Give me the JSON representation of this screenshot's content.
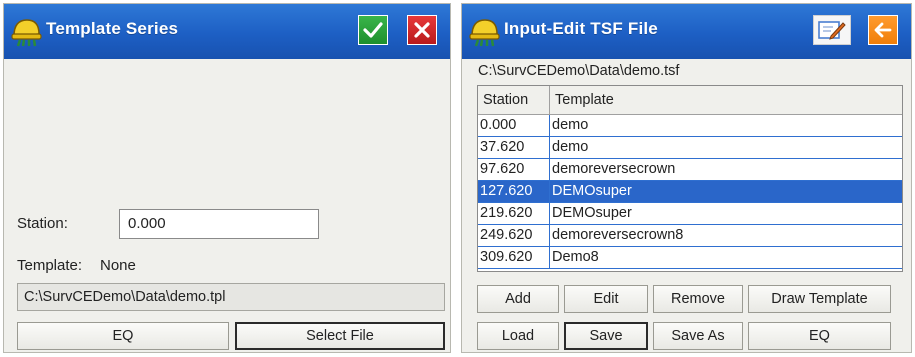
{
  "left_window": {
    "title": "Template Series",
    "station_label": "Station:",
    "station_value": "0.000",
    "template_label": "Template:",
    "template_value": "None",
    "template_path": "C:\\SurvCEDemo\\Data\\demo.tpl",
    "eq_button": "EQ",
    "select_file_button": "Select File"
  },
  "right_window": {
    "title": "Input-Edit TSF File",
    "file_path": "C:\\SurvCEDemo\\Data\\demo.tsf",
    "columns": [
      "Station",
      "Template"
    ],
    "rows": [
      {
        "station": "0.000",
        "template": "demo"
      },
      {
        "station": "37.620",
        "template": "demo"
      },
      {
        "station": "97.620",
        "template": "demoreversecrown"
      },
      {
        "station": "127.620",
        "template": "DEMOsuper"
      },
      {
        "station": "219.620",
        "template": "DEMOsuper"
      },
      {
        "station": "249.620",
        "template": "demoreversecrown8"
      },
      {
        "station": "309.620",
        "template": "Demo8"
      }
    ],
    "selected_row": 3,
    "buttons": {
      "add": "Add",
      "edit": "Edit",
      "remove": "Remove",
      "draw_template": "Draw Template",
      "load": "Load",
      "save": "Save",
      "save_as": "Save As",
      "eq": "EQ"
    }
  },
  "colors": {
    "titlebar": "#1d5fc4",
    "selection": "#2a66c9",
    "ok": "#1e8f2d",
    "cancel": "#b81a1c",
    "back": "#f07f0a"
  },
  "icons": {
    "app": "helmet-icon",
    "ok": "checkmark-icon",
    "cancel": "close-icon",
    "edit": "edit-pencil-icon",
    "back": "back-arrow-icon"
  }
}
